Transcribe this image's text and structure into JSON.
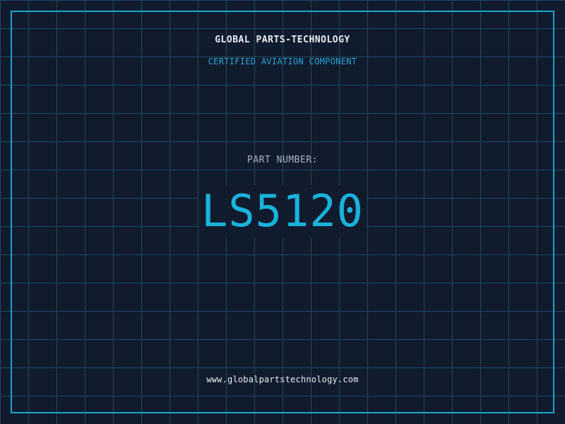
{
  "label": {
    "company": "GLOBAL PARTS-TECHNOLOGY",
    "subtitle": "CERTIFIED AVIATION COMPONENT",
    "part_number_label": "PART NUMBER:",
    "part_number": "LS5120",
    "website": "www.globalpartstechnology.com"
  },
  "colors": {
    "background": "#111b2e",
    "grid": "#1f4a5e",
    "frame": "#1ba3c6",
    "accent": "#19b3dc",
    "text": "#e8eef5",
    "muted": "#aab4c2"
  }
}
